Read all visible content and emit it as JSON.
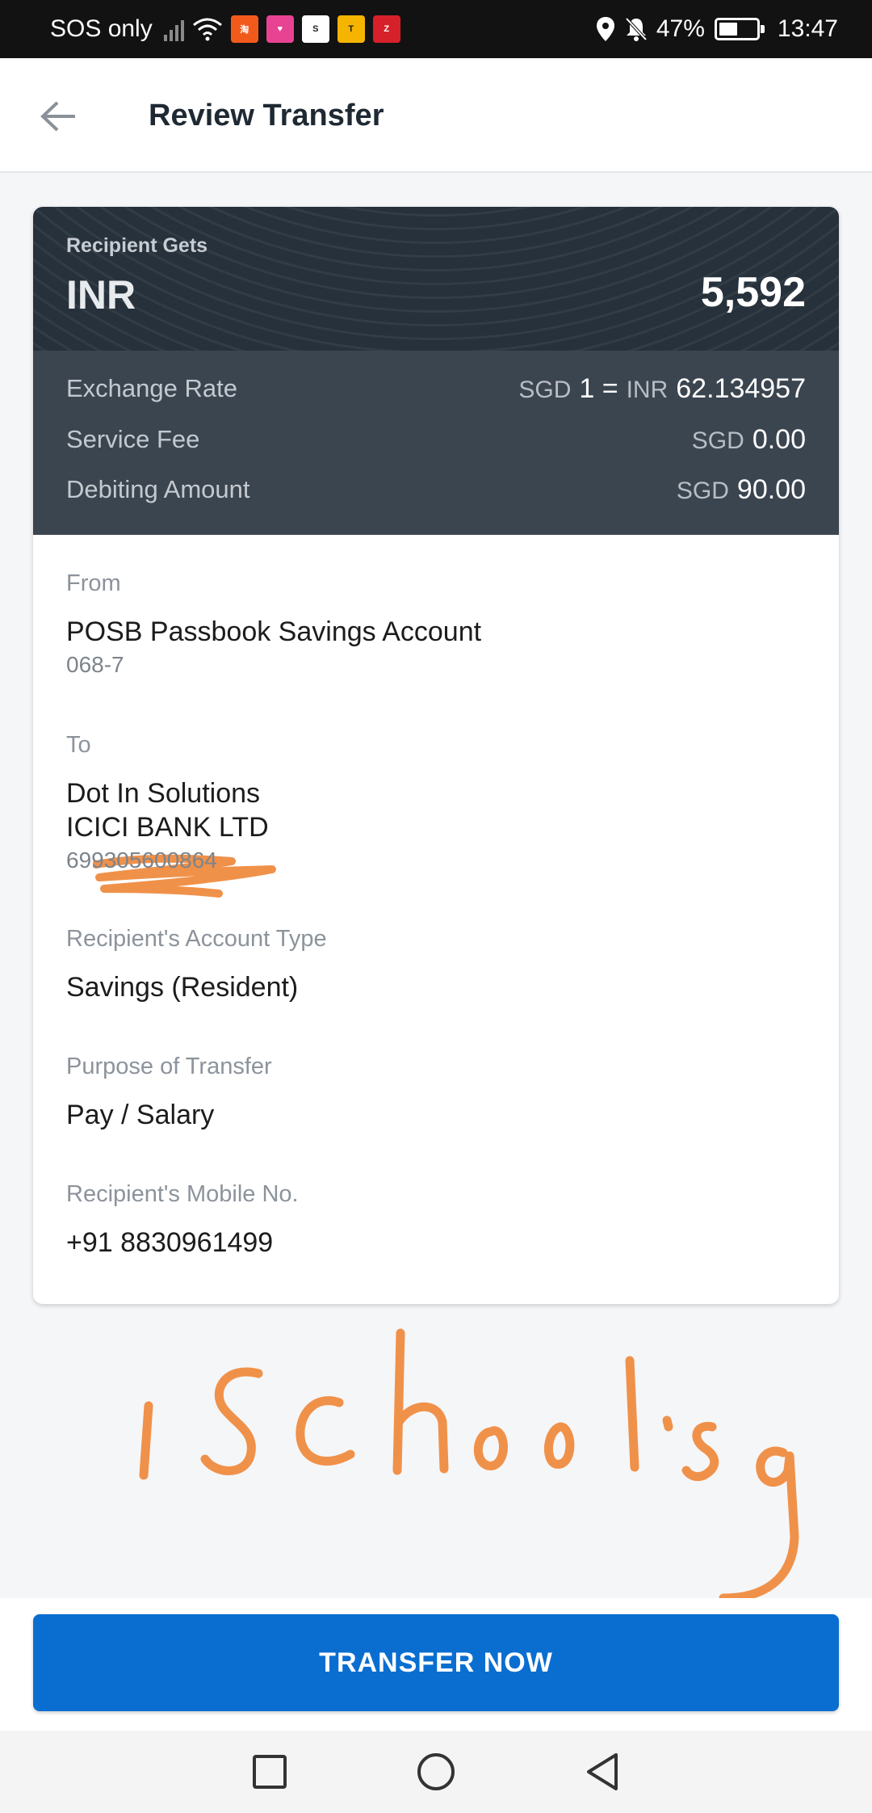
{
  "status_bar": {
    "carrier": "SOS only",
    "battery": "47%",
    "time": "13:47",
    "icons": [
      "no-signal-icon",
      "wifi-icon",
      "taobao-app-icon",
      "lazada-app-icon",
      "shopee-app-icon",
      "tada-app-icon",
      "zalora-app-icon",
      "location-icon",
      "mute-icon",
      "battery-icon"
    ]
  },
  "header": {
    "title": "Review Transfer",
    "back_icon": "arrow-left-icon"
  },
  "summary": {
    "recipient_gets_label": "Recipient Gets",
    "currency": "INR",
    "amount": "5,592"
  },
  "rates": {
    "exchange_rate_label": "Exchange Rate",
    "exchange_from_currency": "SGD",
    "exchange_from_value": "1 =",
    "exchange_to_currency": "INR",
    "exchange_to_value": "62.134957",
    "service_fee_label": "Service Fee",
    "service_fee_currency": "SGD",
    "service_fee_value": "0.00",
    "debiting_label": "Debiting Amount",
    "debiting_currency": "SGD",
    "debiting_value": "90.00"
  },
  "from": {
    "label": "From",
    "account_name": "POSB Passbook Savings Account",
    "account_number_partial": "068-7"
  },
  "to": {
    "label": "To",
    "name": "Dot In Solutions",
    "bank": "ICICI BANK LTD",
    "account_number": "699305600864"
  },
  "account_type": {
    "label": "Recipient's Account Type",
    "value": "Savings (Resident)"
  },
  "purpose": {
    "label": "Purpose of Transfer",
    "value": "Pay / Salary"
  },
  "mobile": {
    "label": "Recipient's Mobile No.",
    "value": "+91 8830961499"
  },
  "watermark": {
    "text": "iSchool.sg",
    "color": "#f0914a"
  },
  "action": {
    "transfer_label": "TRANSFER NOW"
  },
  "colors": {
    "primary": "#0a6ed1",
    "card_dark": "#27313b",
    "card_mid": "#3b4550",
    "redaction": "#f0914a"
  }
}
